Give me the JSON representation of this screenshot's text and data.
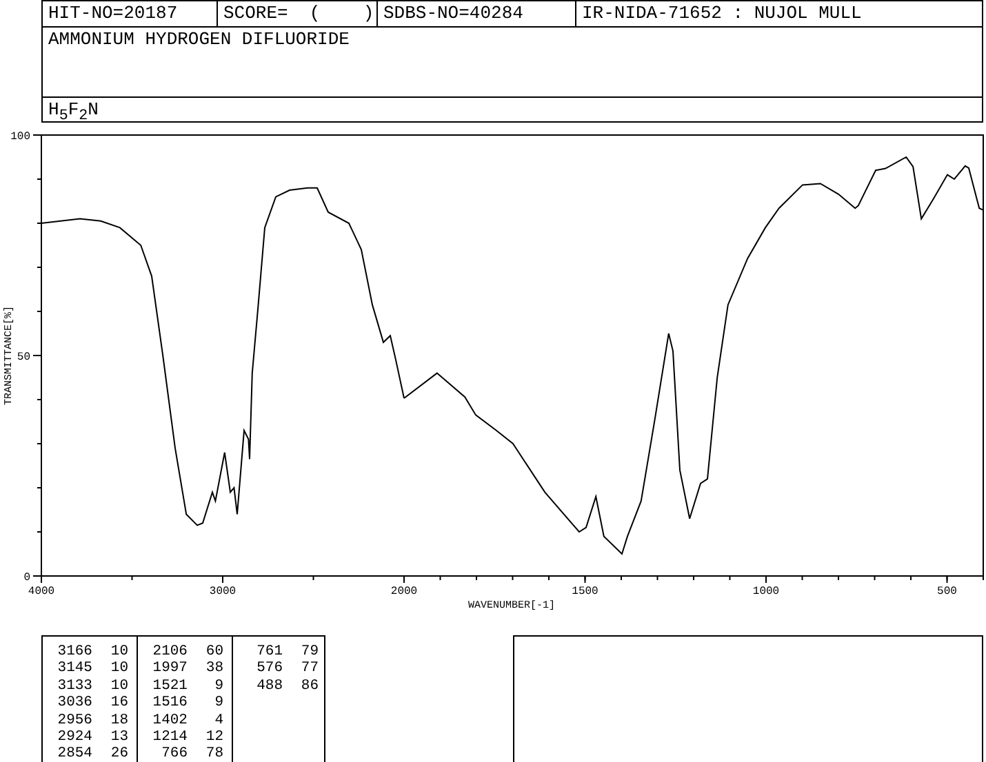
{
  "header": {
    "hit_no": "HIT-NO=20187",
    "score": "SCORE=  (    )",
    "sdbs_no": "SDBS-NO=40284",
    "method": "IR-NIDA-71652 : NUJOL MULL"
  },
  "compound_name": "AMMONIUM HYDROGEN DIFLUORIDE",
  "formula": "H$_{5}$F$_{2}$N",
  "spectrum": {
    "high_range": {
      "chart_data": {
        "type": "line",
        "ylabel": "TRANSMITTANCE[%]",
        "xlim": [
          4000,
          2000
        ],
        "ylim": [
          0,
          100
        ],
        "xticks": [
          4000,
          3000
        ],
        "yticks": [
          0,
          50,
          100
        ],
        "x": [
          4000,
          3787,
          3673,
          3567,
          3452,
          3392,
          3330,
          3262,
          3201,
          3141,
          3110,
          3057,
          3040,
          2989,
          2958,
          2938,
          2920,
          2882,
          2858,
          2852,
          2837,
          2806,
          2768,
          2707,
          2631,
          2532,
          2479,
          2418,
          2304,
          2236,
          2175,
          2114,
          2076,
          2046,
          2000
        ],
        "values": [
          80,
          81,
          80.5,
          79,
          75,
          68,
          50,
          29,
          14,
          11.5,
          12,
          19,
          17,
          28,
          19,
          20,
          14,
          33,
          31,
          26.5,
          46,
          60.5,
          79,
          86,
          87.5,
          88,
          88,
          82.5,
          80,
          74,
          61.5,
          53,
          54.5,
          49,
          40.3
        ]
      }
    },
    "low_range": {
      "chart_data": {
        "type": "line",
        "xlabel": "WAVENUMBER[-1]",
        "xlim": [
          2000,
          400
        ],
        "ylim": [
          0,
          100
        ],
        "xticks": [
          2000,
          1500,
          1000,
          500
        ],
        "x": [
          2000,
          1909,
          1832,
          1802,
          1745,
          1699,
          1611,
          1516,
          1497,
          1470,
          1448,
          1398,
          1383,
          1345,
          1307,
          1269,
          1257,
          1238,
          1211,
          1181,
          1162,
          1135,
          1105,
          1051,
          1002,
          964,
          899,
          850,
          800,
          754,
          745,
          697,
          670,
          613,
          594,
          571,
          537,
          499,
          480,
          450,
          440,
          411,
          400
        ],
        "values": [
          40.3,
          46,
          40.6,
          36.5,
          33,
          30,
          19,
          10,
          11,
          18,
          9,
          5,
          9,
          17,
          35.6,
          55,
          51,
          24,
          13,
          21,
          22,
          45,
          61.5,
          72,
          79,
          83.4,
          88.7,
          89,
          86.6,
          83.4,
          84,
          92,
          92.4,
          95,
          92.8,
          81,
          85.6,
          91,
          90,
          93,
          92.5,
          83.4,
          83
        ]
      }
    }
  },
  "peak_table": {
    "columns": [
      [
        {
          "wavenumber": "3166",
          "transmittance": "10"
        },
        {
          "wavenumber": "3145",
          "transmittance": "10"
        },
        {
          "wavenumber": "3133",
          "transmittance": "10"
        },
        {
          "wavenumber": "3036",
          "transmittance": "16"
        },
        {
          "wavenumber": "2956",
          "transmittance": "18"
        },
        {
          "wavenumber": "2924",
          "transmittance": "13"
        },
        {
          "wavenumber": "2854",
          "transmittance": "26"
        }
      ],
      [
        {
          "wavenumber": "2106",
          "transmittance": "60"
        },
        {
          "wavenumber": "1997",
          "transmittance": "38"
        },
        {
          "wavenumber": "1521",
          "transmittance": "9"
        },
        {
          "wavenumber": "1516",
          "transmittance": "9"
        },
        {
          "wavenumber": "1402",
          "transmittance": "4"
        },
        {
          "wavenumber": "1214",
          "transmittance": "12"
        },
        {
          "wavenumber": "766",
          "transmittance": "78"
        }
      ],
      [
        {
          "wavenumber": "761",
          "transmittance": "79"
        },
        {
          "wavenumber": "576",
          "transmittance": "77"
        },
        {
          "wavenumber": "488",
          "transmittance": "86"
        }
      ]
    ]
  }
}
